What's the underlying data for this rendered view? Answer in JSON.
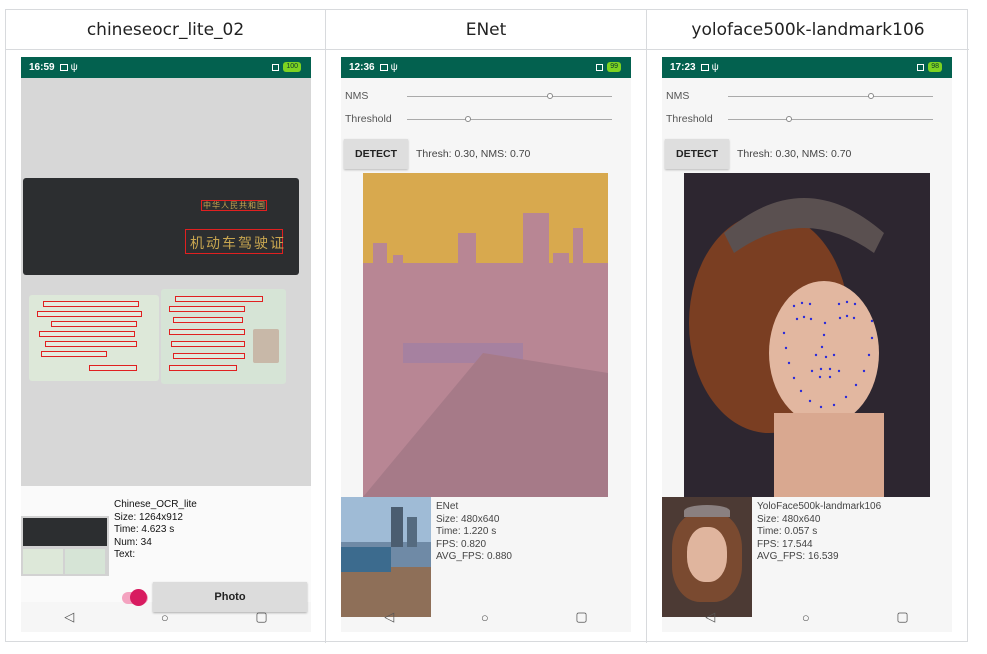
{
  "columns": [
    {
      "title": "chineseocr_lite_02",
      "status_time": "16:59",
      "battery": "100",
      "info": {
        "model": "Chinese_OCR_lite",
        "size": "Size: 1264x912",
        "time": "Time: 4.623 s",
        "num": "Num: 34",
        "text": "Text:"
      },
      "photo_label": "Photo",
      "card_title_cn": "中华人民共和国",
      "card_subtitle_cn": "机动车驾驶证"
    },
    {
      "title": "ENet",
      "status_time": "12:36",
      "battery": "99",
      "nms_label": "NMS",
      "threshold_label": "Threshold",
      "detect_label": "DETECT",
      "thresh_text": "Thresh: 0.30, NMS: 0.70",
      "info": {
        "model": "ENet",
        "size": "Size: 480x640",
        "time": "Time: 1.220 s",
        "fps": "FPS: 0.820",
        "avg_fps": "AVG_FPS: 0.880"
      },
      "nms_value": 0.7,
      "threshold_value": 0.3
    },
    {
      "title": "yoloface500k-landmark106",
      "status_time": "17:23",
      "battery": "98",
      "nms_label": "NMS",
      "threshold_label": "Threshold",
      "detect_label": "DETECT",
      "thresh_text": "Thresh: 0.30, NMS: 0.70",
      "info": {
        "model": "YoloFace500k-landmark106",
        "size": "Size: 480x640",
        "time": "Time: 0.057 s",
        "fps": "FPS: 17.544",
        "avg_fps": "AVG_FPS: 16.539"
      },
      "nms_value": 0.7,
      "threshold_value": 0.3
    }
  ],
  "nav": {
    "back": "◁",
    "home": "○",
    "recents": "▢"
  },
  "colors": {
    "status_bar": "#03614f",
    "accent": "#d81b60",
    "ocr_box": "#e02020",
    "landmark": "#2b2bd9"
  }
}
